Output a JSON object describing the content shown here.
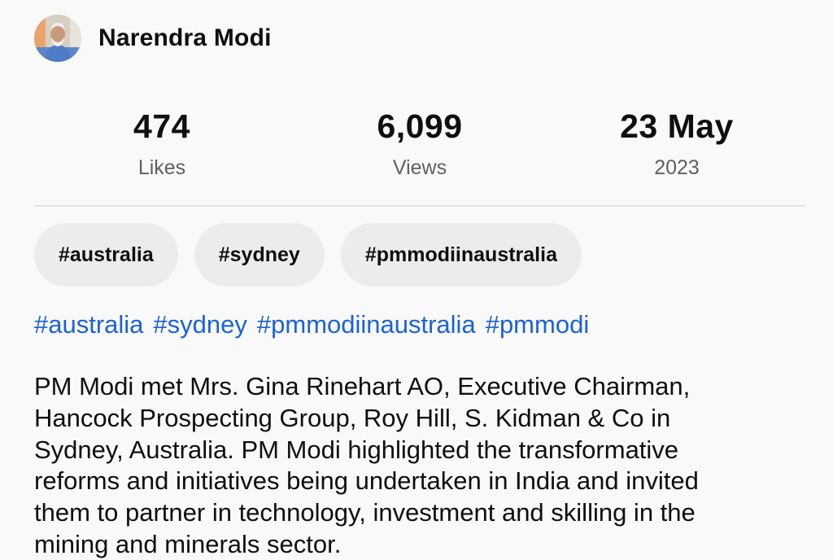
{
  "channel": {
    "name": "Narendra Modi"
  },
  "stats": [
    {
      "value": "474",
      "label": "Likes"
    },
    {
      "value": "6,099",
      "label": "Views"
    },
    {
      "value": "23 May",
      "label": "2023"
    }
  ],
  "chips": [
    "#australia",
    "#sydney",
    "#pmmodiinaustralia"
  ],
  "hashtags": [
    "#australia",
    "#sydney",
    "#pmmodiinaustralia",
    "#pmmodi"
  ],
  "description": [
    "PM Modi met Mrs. Gina Rinehart AO, Executive Chairman,",
    "Hancock Prospecting Group, Roy Hill, S. Kidman & Co in",
    "Sydney, Australia. PM Modi highlighted the transformative",
    "reforms and initiatives being undertaken in India and invited",
    "them to partner in technology, investment and skilling in the",
    "mining and minerals sector."
  ],
  "colors": {
    "background": "#f9f9f9",
    "chip_background": "#ececec",
    "link": "#1c62d8",
    "secondary_text": "#606060"
  }
}
